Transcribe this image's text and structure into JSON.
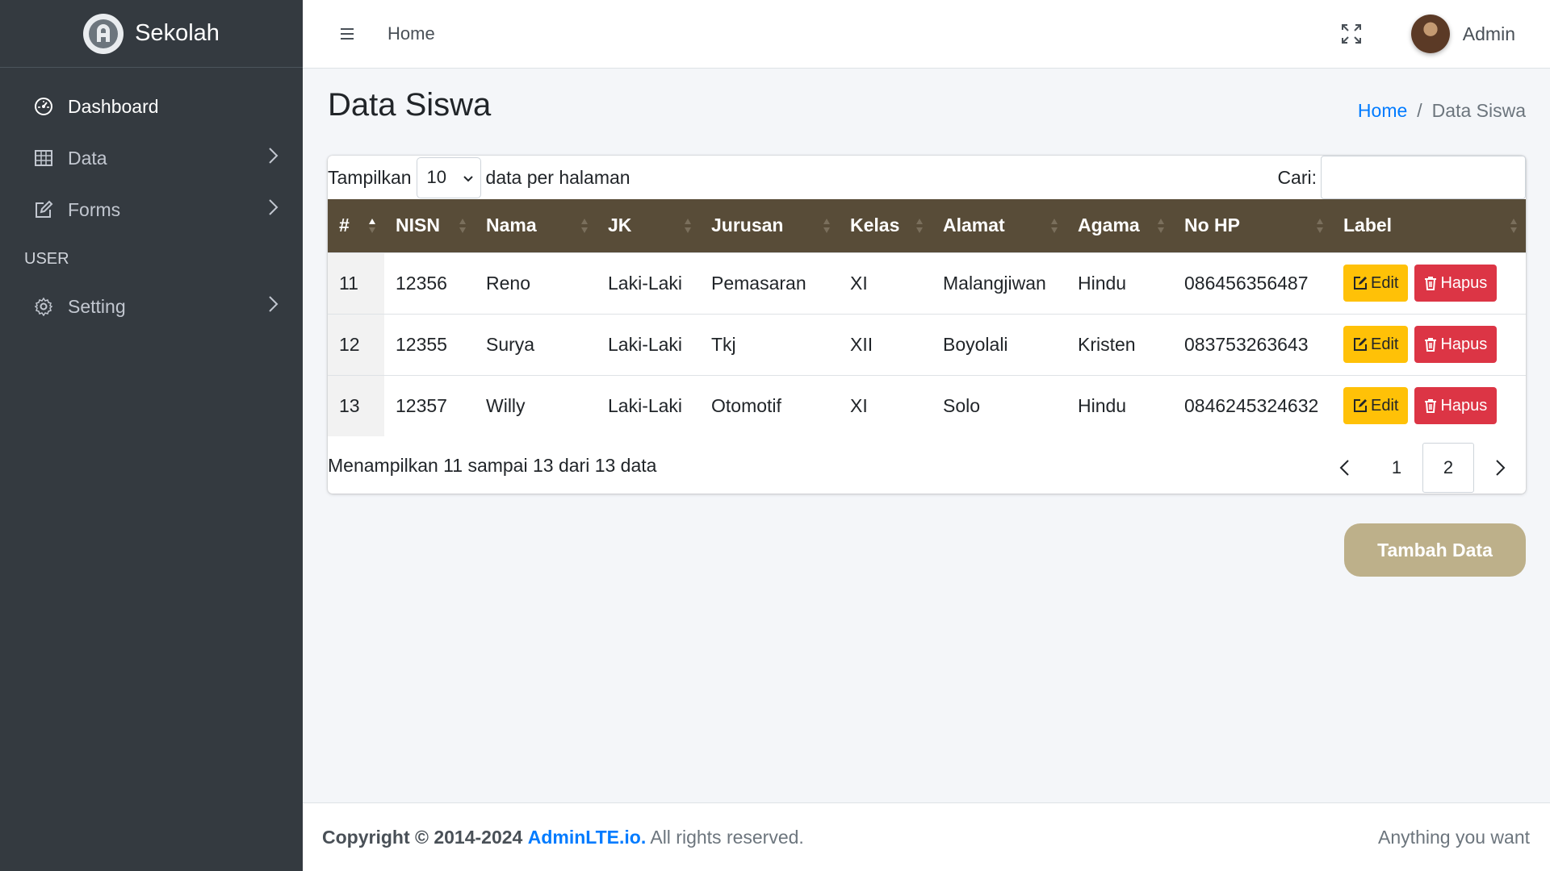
{
  "brand": {
    "name": "Sekolah"
  },
  "sidebar": {
    "items": [
      {
        "label": "Dashboard",
        "icon": "dashboard-icon"
      },
      {
        "label": "Data",
        "icon": "table-icon"
      },
      {
        "label": "Forms",
        "icon": "edit-icon"
      }
    ],
    "header": "USER",
    "setting": {
      "label": "Setting",
      "icon": "gear-icon"
    }
  },
  "topbar": {
    "home": "Home",
    "user": "Admin"
  },
  "page": {
    "title": "Data Siswa"
  },
  "breadcrumb": {
    "home": "Home",
    "separator": "/",
    "current": "Data Siswa"
  },
  "table_controls": {
    "show_label": "Tampilkan",
    "page_length": "10",
    "per_page_label": "data per halaman",
    "search_label": "Cari:",
    "search_value": ""
  },
  "table": {
    "columns": [
      "#",
      "NISN",
      "Nama",
      "JK",
      "Jurusan",
      "Kelas",
      "Alamat",
      "Agama",
      "No HP",
      "Label"
    ],
    "rows": [
      {
        "no": "11",
        "nisn": "12356",
        "nama": "Reno",
        "jk": "Laki-Laki",
        "jurusan": "Pemasaran",
        "kelas": "XI",
        "alamat": "Malangjiwan",
        "agama": "Hindu",
        "hp": "086456356487"
      },
      {
        "no": "12",
        "nisn": "12355",
        "nama": "Surya",
        "jk": "Laki-Laki",
        "jurusan": "Tkj",
        "kelas": "XII",
        "alamat": "Boyolali",
        "agama": "Kristen",
        "hp": "083753263643"
      },
      {
        "no": "13",
        "nisn": "12357",
        "nama": "Willy",
        "jk": "Laki-Laki",
        "jurusan": "Otomotif",
        "kelas": "XI",
        "alamat": "Solo",
        "agama": "Hindu",
        "hp": "0846245324632"
      }
    ],
    "edit_label": "Edit",
    "delete_label": "Hapus",
    "header_color": "#584c38"
  },
  "pagination": {
    "info": "Menampilkan 11 sampai 13 dari 13 data",
    "pages": [
      "1",
      "2"
    ],
    "current": "2"
  },
  "actions": {
    "add_label": "Tambah Data"
  },
  "footer": {
    "copyright": "Copyright © 2014-2024",
    "link": "AdminLTE.io.",
    "rights": "All rights reserved.",
    "right": "Anything you want"
  }
}
